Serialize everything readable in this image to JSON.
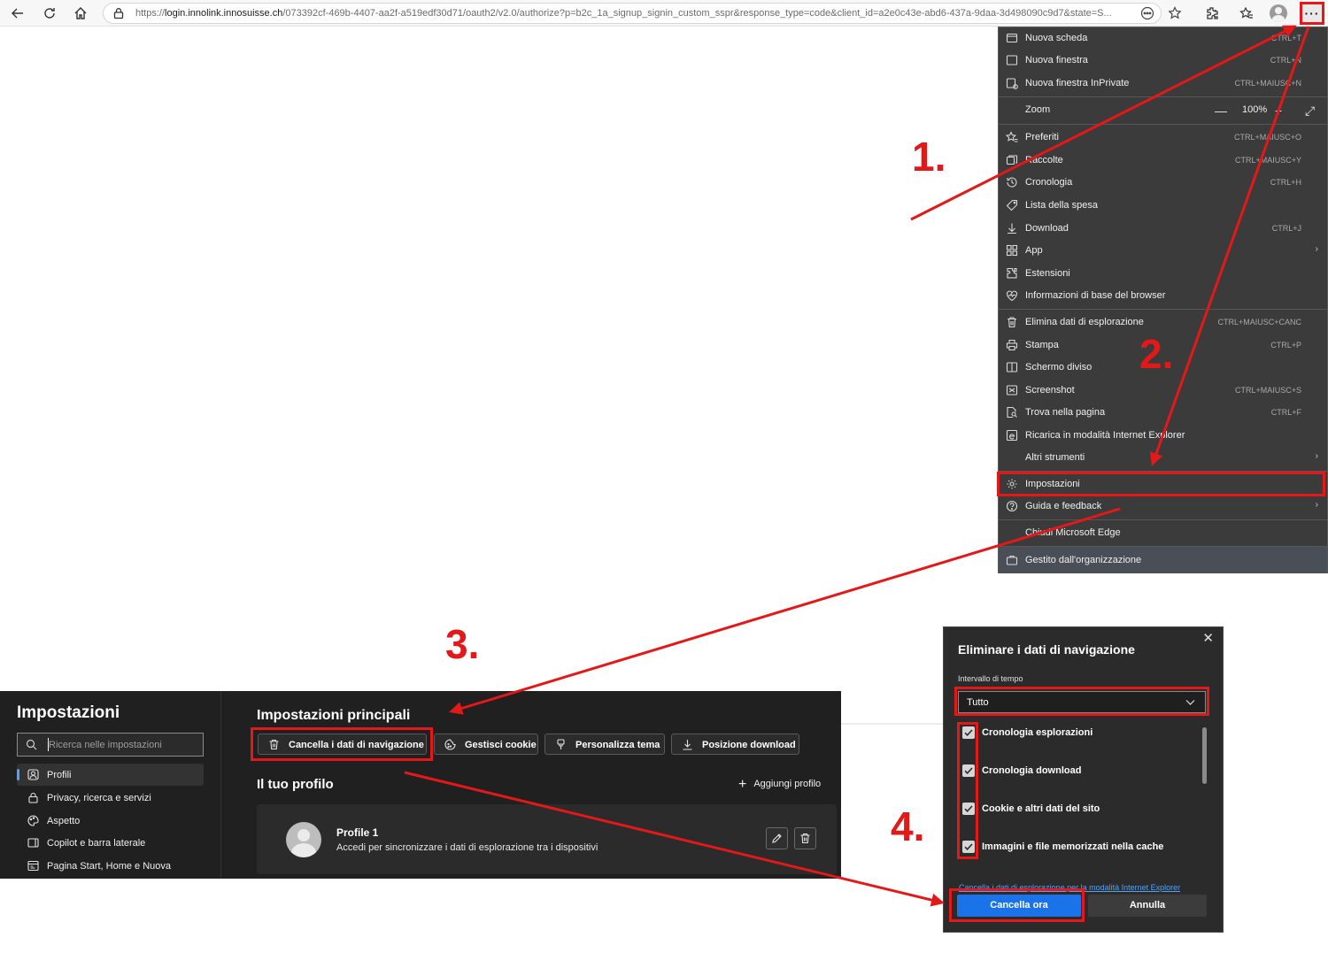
{
  "browser": {
    "url_prefix": "https://",
    "url_host": "login.innolink.innosuisse.ch",
    "url_rest": "/073392cf-469b-4407-aa2f-a519edf30d71/oauth2/v2.0/authorize?p=b2c_1a_signup_signin_custom_sspr&response_type=code&client_id=a2e0c43e-abd6-437a-9daa-3d498090c9d7&state=S...",
    "more_label": "···"
  },
  "menu": {
    "items": [
      {
        "label": "Nuova scheda",
        "shortcut": "CTRL+T"
      },
      {
        "label": "Nuova finestra",
        "shortcut": "CTRL+N"
      },
      {
        "label": "Nuova finestra InPrivate",
        "shortcut": "CTRL+MAIUSC+N"
      },
      {
        "label": "Zoom",
        "value": "100%"
      },
      {
        "label": "Preferiti",
        "shortcut": "CTRL+MAIUSC+O"
      },
      {
        "label": "Raccolte",
        "shortcut": "CTRL+MAIUSC+Y"
      },
      {
        "label": "Cronologia",
        "shortcut": "CTRL+H"
      },
      {
        "label": "Lista della spesa"
      },
      {
        "label": "Download",
        "shortcut": "CTRL+J"
      },
      {
        "label": "App"
      },
      {
        "label": "Estensioni"
      },
      {
        "label": "Informazioni di base del browser"
      },
      {
        "label": "Elimina dati di esplorazione",
        "shortcut": "CTRL+MAIUSC+CANC"
      },
      {
        "label": "Stampa",
        "shortcut": "CTRL+P"
      },
      {
        "label": "Schermo diviso"
      },
      {
        "label": "Screenshot",
        "shortcut": "CTRL+MAIUSC+S"
      },
      {
        "label": "Trova nella pagina",
        "shortcut": "CTRL+F"
      },
      {
        "label": "Ricarica in modalità Internet Explorer"
      },
      {
        "label": "Altri strumenti"
      },
      {
        "label": "Impostazioni"
      },
      {
        "label": "Guida e feedback"
      },
      {
        "label": "Chiudi Microsoft Edge"
      },
      {
        "label": "Gestito dall'organizzazione"
      }
    ]
  },
  "settings": {
    "title": "Impostazioni",
    "search_placeholder": "Ricerca nelle impostazioni",
    "nav": [
      {
        "label": "Profili"
      },
      {
        "label": "Privacy, ricerca e servizi"
      },
      {
        "label": "Aspetto"
      },
      {
        "label": "Copilot e barra laterale"
      },
      {
        "label": "Pagina Start, Home e Nuova"
      }
    ],
    "main_title": "Impostazioni principali",
    "quick_buttons": [
      {
        "label": "Cancella i dati di navigazione"
      },
      {
        "label": "Gestisci cookie"
      },
      {
        "label": "Personalizza tema"
      },
      {
        "label": "Posizione download"
      }
    ],
    "profile_title": "Il tuo profilo",
    "add_profile": "Aggiungi profilo",
    "profile_name": "Profile 1",
    "profile_desc": "Accedi per sincronizzare i dati di esplorazione tra i dispositivi"
  },
  "dialog": {
    "title": "Eliminare i dati di navigazione",
    "range_label": "Intervallo di tempo",
    "range_value": "Tutto",
    "options": [
      {
        "label": "Cronologia esplorazioni",
        "checked": true
      },
      {
        "label": "Cronologia download",
        "checked": true
      },
      {
        "label": "Cookie e altri dati del sito",
        "checked": true
      },
      {
        "label": "Immagini e file memorizzati nella cache",
        "checked": true
      }
    ],
    "ie_link": "Cancella i dati di esplorazione per la modalità Internet Explorer",
    "clear_label": "Cancella ora",
    "cancel_label": "Annulla"
  },
  "annotations": {
    "step1": "1.",
    "step2": "2.",
    "step3": "3.",
    "step4": "4.",
    "color": "#e31818"
  }
}
